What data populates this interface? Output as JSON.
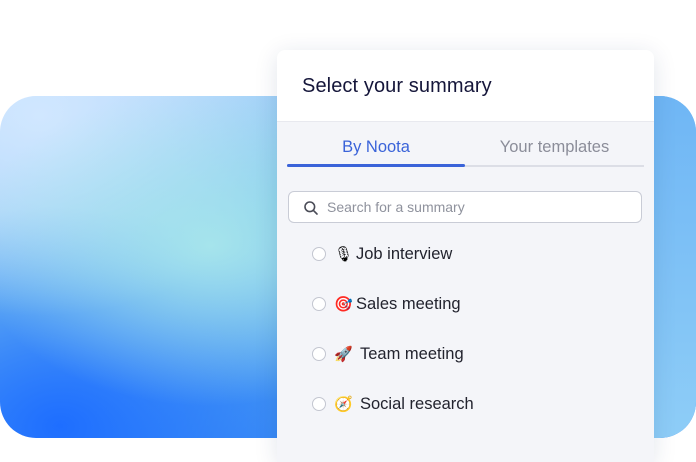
{
  "panel": {
    "title": "Select your summary"
  },
  "tabs": [
    {
      "label": "By Noota",
      "active": true
    },
    {
      "label": "Your templates",
      "active": false
    }
  ],
  "search": {
    "placeholder": "Search for a summary",
    "value": "",
    "icon": "search-icon"
  },
  "options": [
    {
      "emoji": "🎙",
      "icon": "microphone-icon",
      "label": "Job interview",
      "selected": false
    },
    {
      "emoji": "🎯",
      "icon": "target-icon",
      "label": "Sales meeting",
      "selected": false
    },
    {
      "emoji": "🚀",
      "icon": "rocket-icon",
      "label": "Team meeting",
      "selected": false
    },
    {
      "emoji": "🧭",
      "icon": "compass-icon",
      "label": "Social research",
      "selected": false
    }
  ],
  "colors": {
    "accent": "#3a63d9",
    "title": "#15163a",
    "muted": "#8b8d99"
  }
}
